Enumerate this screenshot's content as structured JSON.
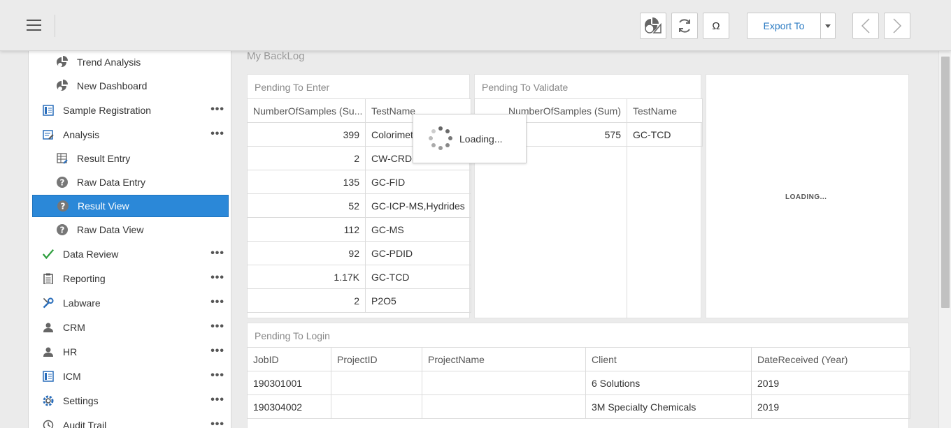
{
  "toolbar": {
    "menu_icon": "hamburger-icon",
    "buttons": [
      "dashboard-settings-icon",
      "refresh-icon",
      "omega-icon"
    ],
    "omega_label": "Ω",
    "export_label": "Export To",
    "nav": [
      "chevron-left-icon",
      "chevron-right-icon"
    ]
  },
  "sidebar": {
    "items": [
      {
        "label": "Trend Analysis",
        "icon": "pie-chart-icon",
        "sub": true,
        "dots": false,
        "active": false
      },
      {
        "label": "New Dashboard",
        "icon": "pie-chart-icon",
        "sub": true,
        "dots": false,
        "active": false
      },
      {
        "label": "Sample Registration",
        "icon": "register-icon",
        "sub": false,
        "dots": true,
        "active": false
      },
      {
        "label": "Analysis",
        "icon": "analysis-icon",
        "sub": false,
        "dots": true,
        "active": false
      },
      {
        "label": "Result Entry",
        "icon": "table-edit-icon",
        "sub": true,
        "dots": false,
        "active": false
      },
      {
        "label": "Raw Data Entry",
        "icon": "question-icon",
        "sub": true,
        "dots": false,
        "active": false
      },
      {
        "label": "Result View",
        "icon": "question-icon",
        "sub": true,
        "dots": false,
        "active": true
      },
      {
        "label": "Raw Data View",
        "icon": "question-icon",
        "sub": true,
        "dots": false,
        "active": false
      },
      {
        "label": "Data Review",
        "icon": "checkmark-icon",
        "sub": false,
        "dots": true,
        "active": false
      },
      {
        "label": "Reporting",
        "icon": "clipboard-icon",
        "sub": false,
        "dots": true,
        "active": false
      },
      {
        "label": "Labware",
        "icon": "wrench-icon",
        "sub": false,
        "dots": true,
        "active": false
      },
      {
        "label": "CRM",
        "icon": "person-icon",
        "sub": false,
        "dots": true,
        "active": false
      },
      {
        "label": "HR",
        "icon": "person-icon",
        "sub": false,
        "dots": true,
        "active": false
      },
      {
        "label": "ICM",
        "icon": "register-icon",
        "sub": false,
        "dots": true,
        "active": false
      },
      {
        "label": "Settings",
        "icon": "gear-icon",
        "sub": false,
        "dots": true,
        "active": false
      },
      {
        "label": "Audit Trail",
        "icon": "history-icon",
        "sub": false,
        "dots": true,
        "active": false
      }
    ],
    "dots_label": "•••"
  },
  "main": {
    "title": "My BackLog",
    "pending_enter": {
      "title": "Pending To Enter",
      "headers": [
        "NumberOfSamples (Su...",
        "TestName"
      ],
      "rows": [
        [
          "399",
          "Colorimet"
        ],
        [
          "2",
          "CW-CRDS"
        ],
        [
          "135",
          "GC-FID"
        ],
        [
          "52",
          "GC-ICP-MS,Hydrides"
        ],
        [
          "112",
          "GC-MS"
        ],
        [
          "92",
          "GC-PDID"
        ],
        [
          "1.17K",
          "GC-TCD"
        ],
        [
          "2",
          "P2O5"
        ]
      ],
      "loading_text": "Loading..."
    },
    "pending_validate": {
      "title": "Pending To Validate",
      "headers": [
        "NumberOfSamples (Sum)",
        "TestName"
      ],
      "rows": [
        [
          "575",
          "GC-TCD"
        ]
      ]
    },
    "third_panel": {
      "loading_text": "LOADING..."
    },
    "pending_login": {
      "title": "Pending To Login",
      "headers": [
        "JobID",
        "ProjectID",
        "ProjectName",
        "Client",
        "DateReceived (Year)"
      ],
      "rows": [
        [
          "190301001",
          "",
          "",
          "6 Solutions",
          "2019"
        ],
        [
          "190304002",
          "",
          "",
          "3M Specialty Chemicals",
          "2019"
        ]
      ]
    }
  }
}
